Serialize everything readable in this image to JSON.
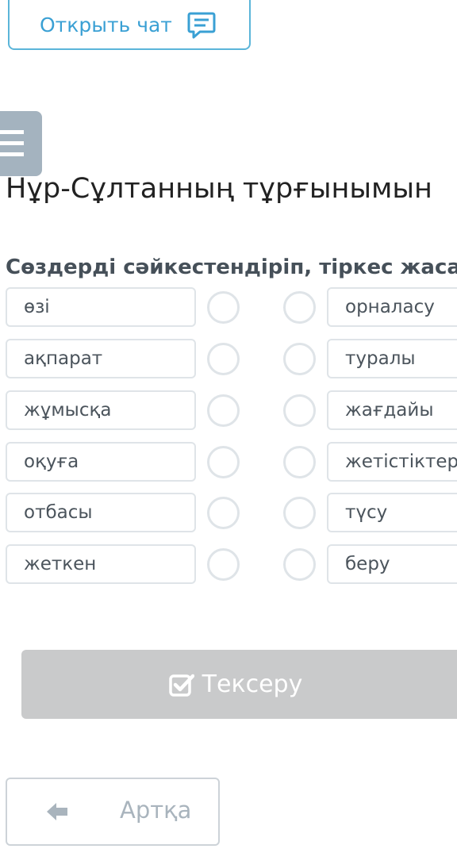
{
  "chat_button": {
    "label": "Открыть чат",
    "icon": "chat-bubble-icon"
  },
  "menu_icon": "hamburger-menu-icon",
  "title": "Нұр-Сұлтанның тұрғынымын",
  "instruction": "Сөздерді сәйкестендіріп, тіркес жаса.",
  "matching": {
    "left": [
      "өзі",
      "ақпарат",
      "жұмысқа",
      "оқуға",
      "отбасы",
      "жеткен"
    ],
    "right": [
      "орналасу",
      "туралы",
      "жағдайы",
      "жетістіктері",
      "түсу",
      "беру"
    ]
  },
  "check_button": {
    "label": "Тексеру",
    "icon": "checkbox-check-icon",
    "color": "#c9cacb"
  },
  "back_button": {
    "label": "Артқа",
    "icon": "arrow-left-icon"
  },
  "colors": {
    "accent": "#3aa0d4",
    "border": "#dfe4e8",
    "menu": "#a4b3bf"
  }
}
